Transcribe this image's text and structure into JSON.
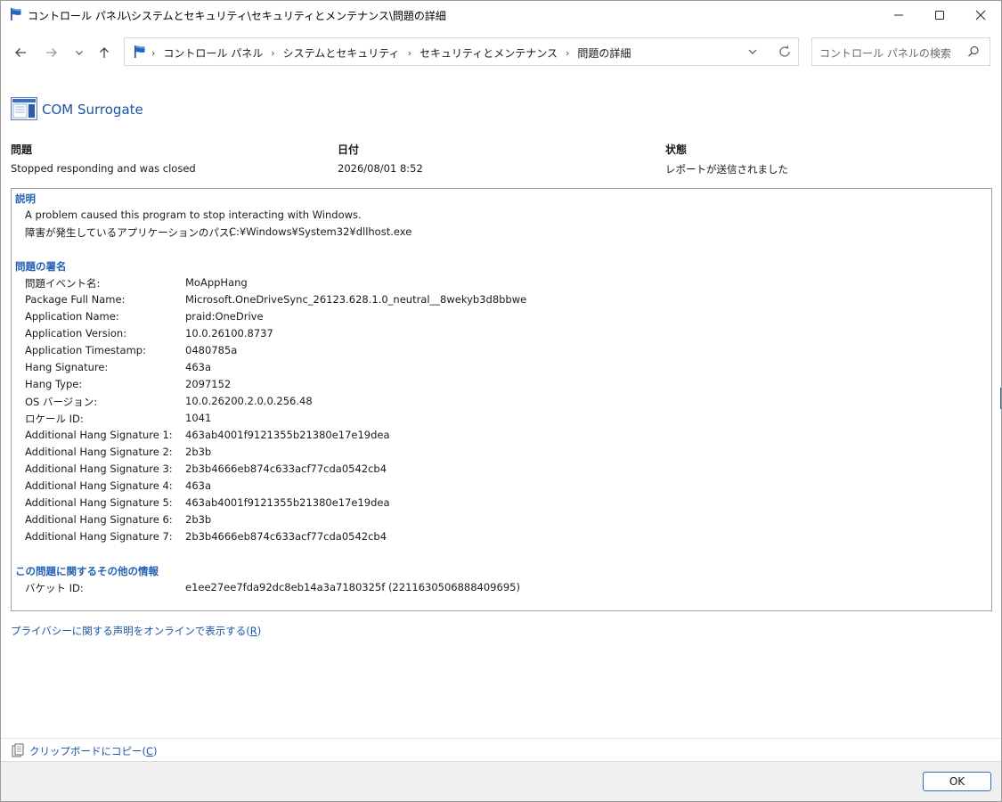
{
  "window": {
    "title": "コントロール パネル\\システムとセキュリティ\\セキュリティとメンテナンス\\問題の詳細",
    "controls": {
      "minimize": "minimize-icon",
      "maximize": "maximize-icon",
      "close": "close-icon"
    }
  },
  "nav": {
    "back_icon": "arrow-left-icon",
    "forward_icon": "arrow-right-icon",
    "recent_icon": "chevron-down-icon",
    "up_icon": "arrow-up-icon",
    "breadcrumbs": [
      "コントロール パネル",
      "システムとセキュリティ",
      "セキュリティとメンテナンス",
      "問題の詳細"
    ],
    "search_placeholder": "コントロール パネルの検索"
  },
  "app": {
    "name": "COM Surrogate"
  },
  "summary": {
    "problem_header": "問題",
    "problem_value": "Stopped responding and was closed",
    "date_header": "日付",
    "date_value": "2026/08/01 8:52",
    "status_header": "状態",
    "status_value": "レポートが送信されました"
  },
  "details": {
    "description_title": "説明",
    "description_text": "A problem caused this program to stop interacting with Windows.",
    "path_label": "障害が発生しているアプリケーションのパス:",
    "path_value": "C:¥Windows¥System32¥dllhost.exe",
    "signature_title": "問題の署名",
    "signature_rows": [
      {
        "label": "問題イベント名:",
        "value": "MoAppHang"
      },
      {
        "label": "Package Full Name:",
        "value": "Microsoft.OneDriveSync_26123.628.1.0_neutral__8wekyb3d8bbwe"
      },
      {
        "label": "Application Name:",
        "value": "praid:OneDrive"
      },
      {
        "label": "Application Version:",
        "value": "10.0.26100.8737"
      },
      {
        "label": "Application Timestamp:",
        "value": "0480785a"
      },
      {
        "label": "Hang Signature:",
        "value": "463a"
      },
      {
        "label": "Hang Type:",
        "value": "2097152"
      },
      {
        "label": "OS バージョン:",
        "value": "10.0.26200.2.0.0.256.48"
      },
      {
        "label": "ロケール ID:",
        "value": "1041"
      },
      {
        "label": "Additional Hang Signature 1:",
        "value": "463ab4001f9121355b21380e17e19dea"
      },
      {
        "label": "Additional Hang Signature 2:",
        "value": "2b3b"
      },
      {
        "label": "Additional Hang Signature 3:",
        "value": "2b3b4666eb874c633acf77cda0542cb4"
      },
      {
        "label": "Additional Hang Signature 4:",
        "value": "463a"
      },
      {
        "label": "Additional Hang Signature 5:",
        "value": "463ab4001f9121355b21380e17e19dea"
      },
      {
        "label": "Additional Hang Signature 6:",
        "value": "2b3b"
      },
      {
        "label": "Additional Hang Signature 7:",
        "value": "2b3b4666eb874c633acf77cda0542cb4"
      }
    ],
    "extra_title": "この問題に関するその他の情報",
    "bucket_label": "バケット ID:",
    "bucket_value": "e1ee27ee7fda92dc8eb14a3a7180325f (2211630506888409695)"
  },
  "links": {
    "privacy": "プライバシーに関する声明をオンラインで表示する(",
    "privacy_key": "R",
    "privacy_end": ")",
    "copy": "クリップボードにコピー(",
    "copy_key": "C",
    "copy_end": ")"
  },
  "buttons": {
    "ok": "OK"
  }
}
